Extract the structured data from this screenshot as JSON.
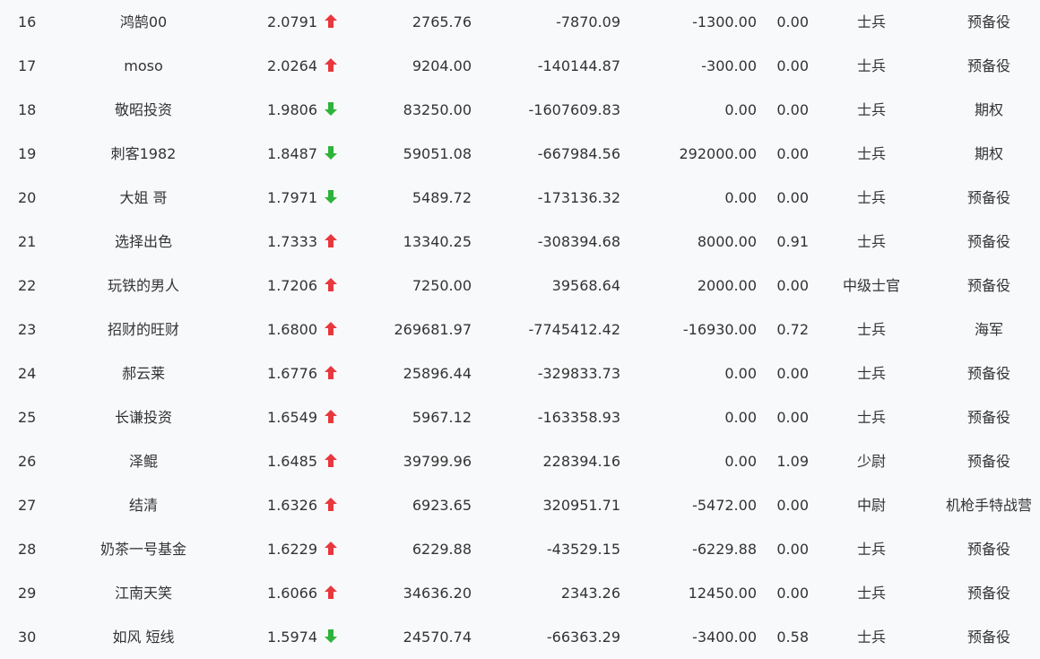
{
  "colors": {
    "up": "#e8383d",
    "down": "#2eb33a",
    "text": "#333333",
    "background": "#f8f9fb"
  },
  "rows": [
    {
      "rank": "16",
      "name": "鸿鹄00",
      "ratio": "2.0791",
      "trend": "up",
      "v1": "2765.76",
      "v2": "-7870.09",
      "v3": "-1300.00",
      "v4": "0.00",
      "level": "士兵",
      "unit": "预备役"
    },
    {
      "rank": "17",
      "name": "moso",
      "ratio": "2.0264",
      "trend": "up",
      "v1": "9204.00",
      "v2": "-140144.87",
      "v3": "-300.00",
      "v4": "0.00",
      "level": "士兵",
      "unit": "预备役"
    },
    {
      "rank": "18",
      "name": "敬昭投资",
      "ratio": "1.9806",
      "trend": "down",
      "v1": "83250.00",
      "v2": "-1607609.83",
      "v3": "0.00",
      "v4": "0.00",
      "level": "士兵",
      "unit": "期权"
    },
    {
      "rank": "19",
      "name": "刺客1982",
      "ratio": "1.8487",
      "trend": "down",
      "v1": "59051.08",
      "v2": "-667984.56",
      "v3": "292000.00",
      "v4": "0.00",
      "level": "士兵",
      "unit": "期权"
    },
    {
      "rank": "20",
      "name": "大姐 哥",
      "ratio": "1.7971",
      "trend": "down",
      "v1": "5489.72",
      "v2": "-173136.32",
      "v3": "0.00",
      "v4": "0.00",
      "level": "士兵",
      "unit": "预备役"
    },
    {
      "rank": "21",
      "name": "选择出色",
      "ratio": "1.7333",
      "trend": "up",
      "v1": "13340.25",
      "v2": "-308394.68",
      "v3": "8000.00",
      "v4": "0.91",
      "level": "士兵",
      "unit": "预备役"
    },
    {
      "rank": "22",
      "name": "玩铁的男人",
      "ratio": "1.7206",
      "trend": "up",
      "v1": "7250.00",
      "v2": "39568.64",
      "v3": "2000.00",
      "v4": "0.00",
      "level": "中级士官",
      "unit": "预备役"
    },
    {
      "rank": "23",
      "name": "招财的旺财",
      "ratio": "1.6800",
      "trend": "up",
      "v1": "269681.97",
      "v2": "-7745412.42",
      "v3": "-16930.00",
      "v4": "0.72",
      "level": "士兵",
      "unit": "海军"
    },
    {
      "rank": "24",
      "name": "郝云莱",
      "ratio": "1.6776",
      "trend": "up",
      "v1": "25896.44",
      "v2": "-329833.73",
      "v3": "0.00",
      "v4": "0.00",
      "level": "士兵",
      "unit": "预备役"
    },
    {
      "rank": "25",
      "name": "长谦投资",
      "ratio": "1.6549",
      "trend": "up",
      "v1": "5967.12",
      "v2": "-163358.93",
      "v3": "0.00",
      "v4": "0.00",
      "level": "士兵",
      "unit": "预备役"
    },
    {
      "rank": "26",
      "name": "泽鲲",
      "ratio": "1.6485",
      "trend": "up",
      "v1": "39799.96",
      "v2": "228394.16",
      "v3": "0.00",
      "v4": "1.09",
      "level": "少尉",
      "unit": "预备役"
    },
    {
      "rank": "27",
      "name": "结清",
      "ratio": "1.6326",
      "trend": "up",
      "v1": "6923.65",
      "v2": "320951.71",
      "v3": "-5472.00",
      "v4": "0.00",
      "level": "中尉",
      "unit": "机枪手特战营"
    },
    {
      "rank": "28",
      "name": "奶茶一号基金",
      "ratio": "1.6229",
      "trend": "up",
      "v1": "6229.88",
      "v2": "-43529.15",
      "v3": "-6229.88",
      "v4": "0.00",
      "level": "士兵",
      "unit": "预备役"
    },
    {
      "rank": "29",
      "name": "江南天笑",
      "ratio": "1.6066",
      "trend": "up",
      "v1": "34636.20",
      "v2": "2343.26",
      "v3": "12450.00",
      "v4": "0.00",
      "level": "士兵",
      "unit": "预备役"
    },
    {
      "rank": "30",
      "name": "如风 短线",
      "ratio": "1.5974",
      "trend": "down",
      "v1": "24570.74",
      "v2": "-66363.29",
      "v3": "-3400.00",
      "v4": "0.58",
      "level": "士兵",
      "unit": "预备役"
    }
  ]
}
